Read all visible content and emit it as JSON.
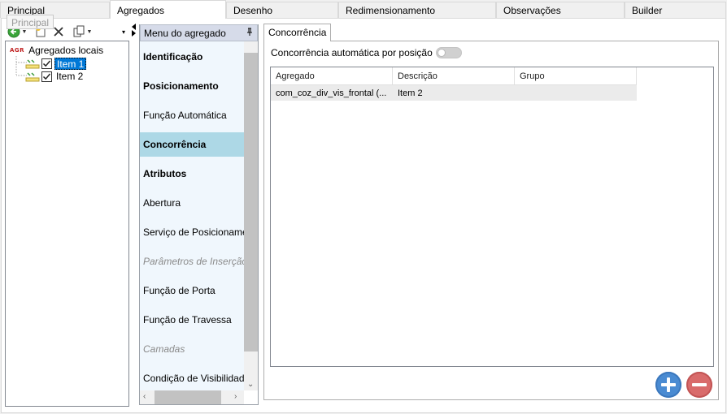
{
  "top_tabs": [
    "Principal",
    "Agregados",
    "Desenho",
    "Redimensionamento",
    "Observações",
    "Builder"
  ],
  "active_tab": "Agregados",
  "tooltip": "Principal",
  "tree": {
    "root_icon_text": "AGR",
    "root_label": "Agregados locais",
    "items": [
      {
        "label": "Item 1",
        "checked": true,
        "selected": true
      },
      {
        "label": "Item 2",
        "checked": true,
        "selected": false
      }
    ]
  },
  "menu": {
    "header": "Menu do agregado",
    "items": [
      {
        "label": "Identificação",
        "style": "bold"
      },
      {
        "label": "Posicionamento",
        "style": "bold"
      },
      {
        "label": "Função Automática",
        "style": "normal"
      },
      {
        "label": "Concorrência",
        "style": "bold-active"
      },
      {
        "label": "Atributos",
        "style": "bold"
      },
      {
        "label": "Abertura",
        "style": "normal"
      },
      {
        "label": "Serviço de Posicionamen",
        "style": "normal"
      },
      {
        "label": "Parâmetros de Inserção",
        "style": "disabled"
      },
      {
        "label": "Função de Porta",
        "style": "normal"
      },
      {
        "label": "Função de Travessa",
        "style": "normal"
      },
      {
        "label": "Camadas",
        "style": "disabled"
      },
      {
        "label": "Condição de Visibilidade",
        "style": "normal"
      }
    ]
  },
  "content": {
    "sub_tab": "Concorrência",
    "toggle_label": "Concorrência automática por posição",
    "toggle_on": false,
    "grid": {
      "columns": [
        "Agregado",
        "Descrição",
        "Grupo"
      ],
      "rows": [
        [
          "com_coz_div_vis_frontal (...",
          "Item 2",
          ""
        ]
      ]
    }
  },
  "colors": {
    "selection": "#0078d7",
    "menu_active": "#add8e6",
    "menu_bg": "#f0f7fd",
    "add_button": "#4a8bd2",
    "remove_button": "#d96b6b"
  }
}
